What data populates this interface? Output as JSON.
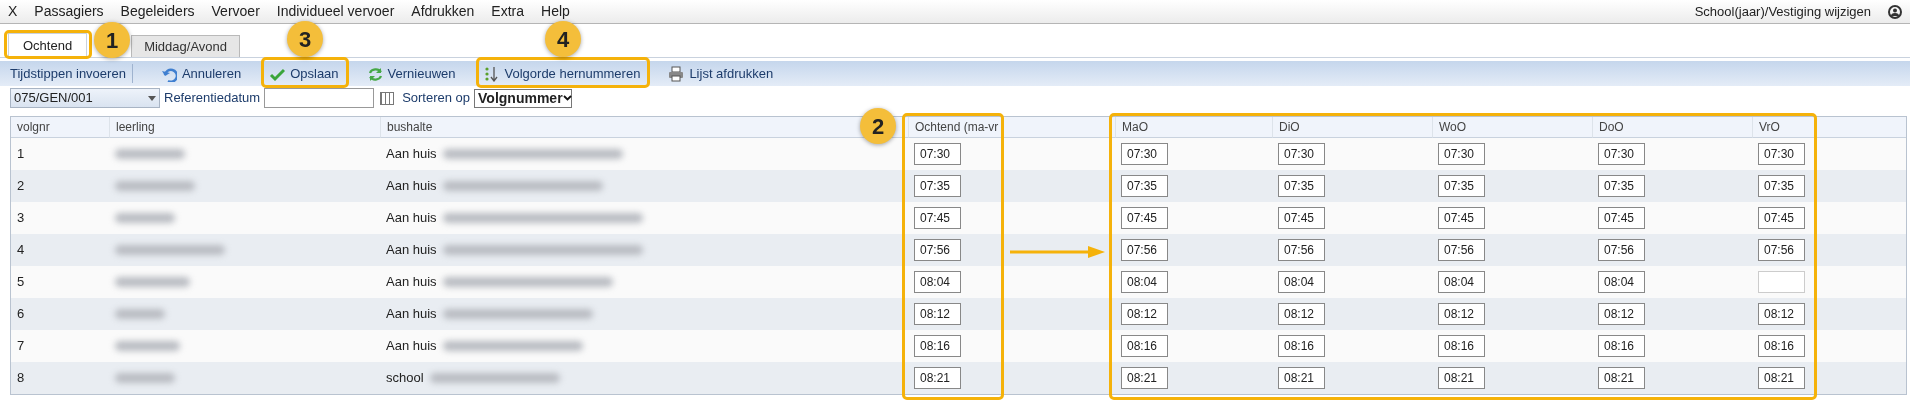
{
  "menu": {
    "close": "X",
    "items": [
      "Passagiers",
      "Begeleiders",
      "Vervoer",
      "Individueel vervoer",
      "Afdrukken",
      "Extra",
      "Help"
    ],
    "account_link": "School(jaar)/Vestiging wijzigen"
  },
  "tabs": [
    {
      "label": "Ochtend",
      "selected": true
    },
    {
      "label": "Middag/Avond",
      "selected": false
    }
  ],
  "toolbar": {
    "title": "Tijdstippen invoeren",
    "buttons": [
      {
        "label": "Annuleren",
        "kind": "undo"
      },
      {
        "label": "Opslaan",
        "kind": "save"
      },
      {
        "label": "Vernieuwen",
        "kind": "refresh"
      },
      {
        "label": "Volgorde hernummeren",
        "kind": "renumber"
      },
      {
        "label": "Lijst afdrukken",
        "kind": "print"
      }
    ]
  },
  "filters": {
    "route": "075/GEN/001",
    "date_label": "Referentiedatum",
    "sort_label": "Sorteren op",
    "sort_value": "Volgnummer"
  },
  "table": {
    "columns": [
      "volgnr",
      "leerling",
      "bushalte",
      "Ochtend (ma-vr",
      "MaO",
      "DiO",
      "WoO",
      "DoO",
      "VrO"
    ],
    "rows": [
      {
        "volgnr": "1",
        "stop": "Aan huis",
        "ochtend": "07:30",
        "days": [
          "07:30",
          "07:30",
          "07:30",
          "07:30",
          "07:30"
        ],
        "vro_filled": true
      },
      {
        "volgnr": "2",
        "stop": "Aan huis",
        "ochtend": "07:35",
        "days": [
          "07:35",
          "07:35",
          "07:35",
          "07:35",
          "07:35"
        ],
        "vro_filled": true
      },
      {
        "volgnr": "3",
        "stop": "Aan huis",
        "ochtend": "07:45",
        "days": [
          "07:45",
          "07:45",
          "07:45",
          "07:45",
          "07:45"
        ],
        "vro_filled": true
      },
      {
        "volgnr": "4",
        "stop": "Aan huis",
        "ochtend": "07:56",
        "days": [
          "07:56",
          "07:56",
          "07:56",
          "07:56",
          "07:56"
        ],
        "vro_filled": true
      },
      {
        "volgnr": "5",
        "stop": "Aan huis",
        "ochtend": "08:04",
        "days": [
          "08:04",
          "08:04",
          "08:04",
          "08:04"
        ],
        "vro_filled": false
      },
      {
        "volgnr": "6",
        "stop": "Aan huis",
        "ochtend": "08:12",
        "days": [
          "08:12",
          "08:12",
          "08:12",
          "08:12",
          "08:12"
        ],
        "vro_filled": true
      },
      {
        "volgnr": "7",
        "stop": "Aan huis",
        "ochtend": "08:16",
        "days": [
          "08:16",
          "08:16",
          "08:16",
          "08:16",
          "08:16"
        ],
        "vro_filled": true
      },
      {
        "volgnr": "8",
        "stop": "school",
        "ochtend": "08:21",
        "days": [
          "08:21",
          "08:21",
          "08:21",
          "08:21",
          "08:21"
        ],
        "vro_filled": true
      }
    ]
  },
  "annotations": [
    "1",
    "2",
    "3",
    "4"
  ]
}
